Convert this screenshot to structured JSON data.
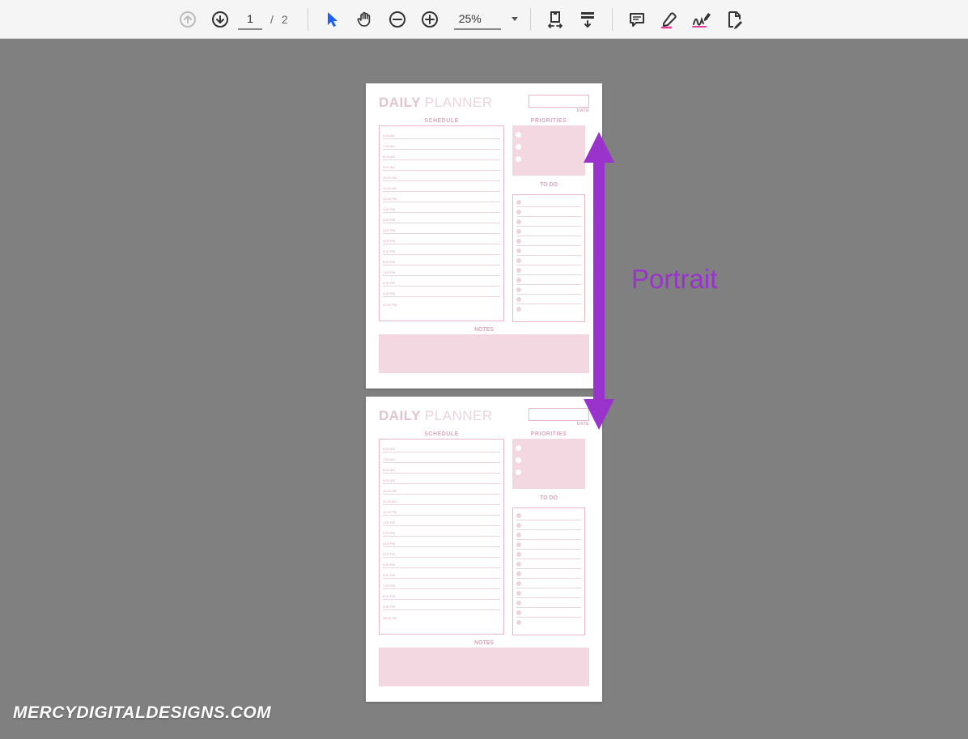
{
  "toolbar": {
    "current_page": "1",
    "page_separator": "/",
    "total_pages": "2",
    "zoom_value": "25%"
  },
  "annotation": {
    "label": "Portrait",
    "color": "#9933cc"
  },
  "watermark": "MERCYDIGITALDESIGNS.COM",
  "planner": {
    "title_bold": "DAILY",
    "title_light": "PLANNER",
    "date_label": "DATE",
    "schedule_label": "SCHEDULE",
    "priorities_label": "PRIORITIES",
    "todo_label": "TO DO",
    "notes_label": "NOTES",
    "schedule_times": [
      "6:00 AM",
      "7:00 AM",
      "8:00 AM",
      "9:00 AM",
      "10:00 AM",
      "11:00 AM",
      "12:00 PM",
      "1:00 PM",
      "2:00 PM",
      "3:00 PM",
      "4:00 PM",
      "5:00 PM",
      "6:00 PM",
      "7:00 PM",
      "8:00 PM",
      "9:00 PM",
      "10:00 PM"
    ],
    "priorities_count": 3,
    "todo_count": 12
  }
}
